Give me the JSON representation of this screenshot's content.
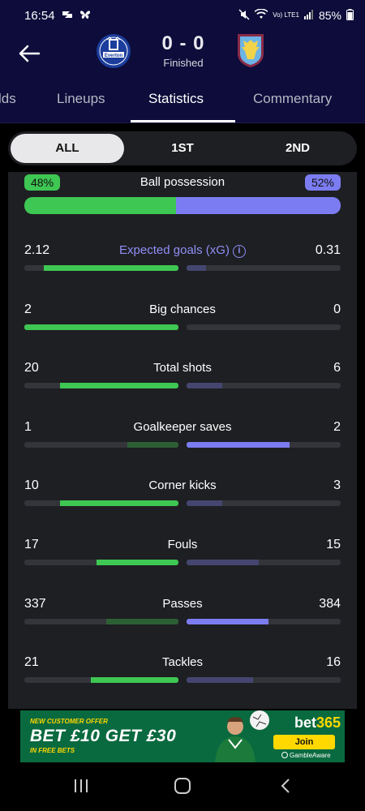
{
  "status_bar": {
    "time": "16:54",
    "network": "Vo) LTE1",
    "battery": "85%"
  },
  "match": {
    "home_team": "Everton",
    "away_team": "Aston Villa",
    "score": "0 - 0",
    "status": "Finished"
  },
  "tabs": [
    {
      "label": "lds"
    },
    {
      "label": "Lineups"
    },
    {
      "label": "Statistics"
    },
    {
      "label": "Commentary"
    }
  ],
  "periods": [
    {
      "label": "ALL"
    },
    {
      "label": "1ST"
    },
    {
      "label": "2ND"
    }
  ],
  "colors": {
    "home_win": "#3ec753",
    "home_lose": "#2d5f35",
    "away_win": "#7c7cf2",
    "away_lose": "#45466f",
    "header_bg": "#0d0c3a"
  },
  "possession": {
    "label": "Ball possession",
    "home": "48%",
    "away": "52%",
    "home_value": 48,
    "away_value": 52
  },
  "stats": [
    {
      "label": "Expected goals (xG)",
      "home": "2.12",
      "away": "0.31",
      "home_value": 2.12,
      "away_value": 0.31,
      "info": true
    },
    {
      "label": "Big chances",
      "home": "2",
      "away": "0",
      "home_value": 2,
      "away_value": 0
    },
    {
      "label": "Total shots",
      "home": "20",
      "away": "6",
      "home_value": 20,
      "away_value": 6
    },
    {
      "label": "Goalkeeper saves",
      "home": "1",
      "away": "2",
      "home_value": 1,
      "away_value": 2
    },
    {
      "label": "Corner kicks",
      "home": "10",
      "away": "3",
      "home_value": 10,
      "away_value": 3
    },
    {
      "label": "Fouls",
      "home": "17",
      "away": "15",
      "home_value": 17,
      "away_value": 15
    },
    {
      "label": "Passes",
      "home": "337",
      "away": "384",
      "home_value": 337,
      "away_value": 384
    },
    {
      "label": "Tackles",
      "home": "21",
      "away": "16",
      "home_value": 21,
      "away_value": 16
    }
  ],
  "ad": {
    "offer": "NEW CUSTOMER OFFER",
    "headline": "BET £10 GET £30",
    "sub": "IN FREE BETS",
    "brand": "bet",
    "brand_num": "365",
    "cta": "Join",
    "gamble_aware": "GambleAware"
  },
  "icons": {
    "back": "arrow-left-icon",
    "info": "info-icon"
  }
}
